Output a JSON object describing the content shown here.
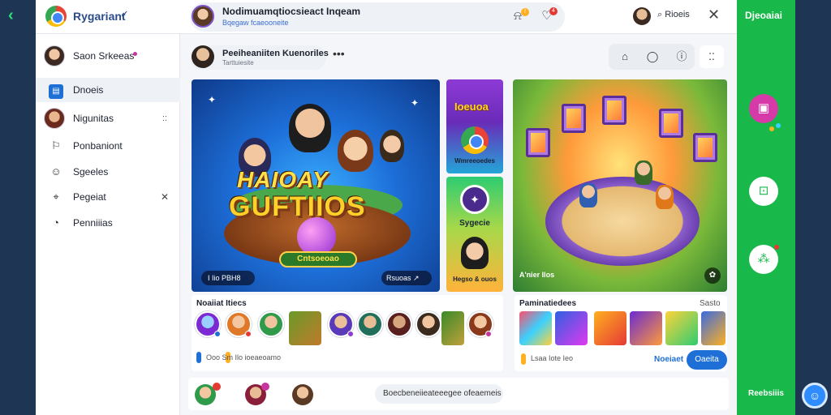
{
  "app": {
    "brand": "Rygariant",
    "brand_check": "✓"
  },
  "topbar": {
    "title": "Nodimuamqtiocsieact Inqeam",
    "subtitle": "Bqegaw fcaeooneite",
    "icons": [
      "bell-icon",
      "heart-icon"
    ],
    "badge_1": "!",
    "badge_2": "4",
    "search_label": "Rioeis",
    "close": "✕"
  },
  "sidebar": {
    "items": [
      {
        "label": "Saon Srkeeas",
        "icon": "avatar"
      },
      {
        "label": "Dnoeis",
        "icon": "doc-icon"
      },
      {
        "label": "Nigunitas",
        "icon": "avatar"
      },
      {
        "label": "Ponbaniont",
        "icon": "flag-icon"
      },
      {
        "label": "Sgeeles",
        "icon": "smile-icon"
      },
      {
        "label": "Pegeiat",
        "icon": "map-icon"
      },
      {
        "label": "Penniiias",
        "icon": "clock-icon"
      }
    ],
    "item_marks": [
      "::",
      "✕"
    ]
  },
  "content": {
    "header": {
      "title": "Peeiheaniiten Kuenoriles",
      "subtitle": "Tarttuiesite",
      "menu": "•••"
    },
    "grid_button": "⁚⁚",
    "hero": {
      "title_1": "HAIOAY",
      "title_2": "GUFTIIOS",
      "chip": "Cntsoeoao",
      "tag_left": "I Iio PBH8",
      "tag_right": "Rsuoas",
      "tag_right_icon": "↗"
    },
    "tile_1": {
      "title": "Ioeuoa",
      "caption": "Wmreeoedes"
    },
    "tile_2": {
      "title": "Sygecie",
      "caption": "Hegso & ouos"
    },
    "hero2": {
      "tag_left": "A'nier Ilos",
      "corner": "✿"
    },
    "friends": {
      "title": "Noaiiat Itiecs",
      "footer": "Ooo Sm Ilo ioeaeoamo"
    },
    "apps": {
      "title": "Paminatiedees",
      "more": "Sasto",
      "footer": "Lsaa Iote Ieo"
    },
    "composer": {
      "placeholder": "Boecbeneiieateeegee ofeaemeis",
      "link": "Noeiaet",
      "button": "Oaeita"
    }
  },
  "right_panel": {
    "title": "Djeoaiai",
    "footer": "Reebsiiis"
  },
  "colors": {
    "accent": "#18b94a",
    "primary": "#1e6fd6",
    "navy": "#1e3553"
  }
}
